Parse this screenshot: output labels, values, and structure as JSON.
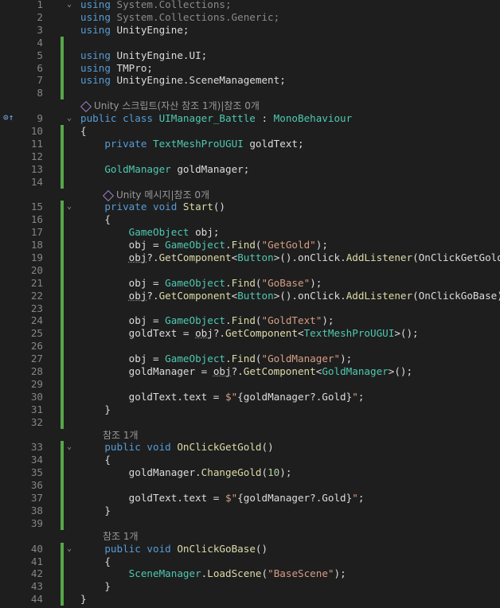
{
  "lenses": {
    "class_refs": "Unity 스크립트(자산 참조 1개)|참조 0개",
    "start_refs": "Unity 메시지|참조 0개",
    "getgold_refs": "참조 1개",
    "gobase_refs": "참조 1개"
  },
  "colors": {
    "added_line_marker": "#57a64a",
    "keyword": "#569cd6",
    "type": "#4ec9b0",
    "string": "#d69d85",
    "method": "#dcdcaa"
  },
  "lines": [
    {
      "n": "1",
      "t": [
        [
          "kw",
          "using "
        ],
        [
          "dim",
          "System.Collections;"
        ]
      ],
      "fold": "⌄",
      "mod": false
    },
    {
      "n": "2",
      "t": [
        [
          "kw",
          "using "
        ],
        [
          "dim",
          "System.Collections.Generic;"
        ]
      ],
      "mod": false
    },
    {
      "n": "3",
      "t": [
        [
          "kw",
          "using "
        ],
        [
          "pl",
          "UnityEngine;"
        ]
      ],
      "mod": false
    },
    {
      "n": "4",
      "t": [],
      "mod": true
    },
    {
      "n": "5",
      "t": [
        [
          "kw",
          "using "
        ],
        [
          "pl",
          "UnityEngine.UI;"
        ]
      ],
      "mod": true
    },
    {
      "n": "6",
      "t": [
        [
          "kw",
          "using "
        ],
        [
          "pl",
          "TMPro;"
        ]
      ],
      "mod": true
    },
    {
      "n": "7",
      "t": [
        [
          "kw",
          "using "
        ],
        [
          "pl",
          "UnityEngine.SceneManagement;"
        ]
      ],
      "mod": true
    },
    {
      "n": "8",
      "t": [],
      "mod": true
    },
    {
      "lens": "class_refs",
      "indent": 0
    },
    {
      "n": "9",
      "t": [
        [
          "kw",
          "public class "
        ],
        [
          "ty",
          "UIManager_Battle"
        ],
        [
          "pl",
          " : "
        ],
        [
          "ty",
          "MonoBehaviour"
        ]
      ],
      "fold": "⌄",
      "bookmark": true
    },
    {
      "n": "10",
      "t": [
        [
          "pl",
          "{"
        ]
      ],
      "mod": true
    },
    {
      "n": "11",
      "t": [
        [
          "pl",
          "    "
        ],
        [
          "kw",
          "private "
        ],
        [
          "ty",
          "TextMeshProUGUI"
        ],
        [
          "pl",
          " goldText;"
        ]
      ],
      "mod": true
    },
    {
      "n": "12",
      "t": [],
      "mod": true
    },
    {
      "n": "13",
      "t": [
        [
          "pl",
          "    "
        ],
        [
          "ty",
          "GoldManager"
        ],
        [
          "pl",
          " goldManager;"
        ]
      ],
      "mod": true
    },
    {
      "n": "14",
      "t": [],
      "mod": true
    },
    {
      "lens": "start_refs",
      "indent": 1
    },
    {
      "n": "15",
      "t": [
        [
          "pl",
          "    "
        ],
        [
          "kw",
          "private void "
        ],
        [
          "mth",
          "Start"
        ],
        [
          "pl",
          "()"
        ]
      ],
      "fold": "⌄",
      "mod": true
    },
    {
      "n": "16",
      "t": [
        [
          "pl",
          "    {"
        ]
      ],
      "mod": true
    },
    {
      "n": "17",
      "t": [
        [
          "pl",
          "        "
        ],
        [
          "ty",
          "GameObject"
        ],
        [
          "pl",
          " obj;"
        ]
      ],
      "mod": true
    },
    {
      "n": "18",
      "t": [
        [
          "pl",
          "        obj = "
        ],
        [
          "ty",
          "GameObject"
        ],
        [
          "pl",
          "."
        ],
        [
          "mth",
          "Find"
        ],
        [
          "pl",
          "("
        ],
        [
          "str",
          "\"GetGold\""
        ],
        [
          "pl",
          ");"
        ]
      ],
      "mod": true
    },
    {
      "n": "19",
      "t": [
        [
          "pl",
          "        "
        ],
        [
          "sq",
          "obj"
        ],
        [
          "pl",
          "?."
        ],
        [
          "mth",
          "GetComponent"
        ],
        [
          "pl",
          "<"
        ],
        [
          "ty",
          "Button"
        ],
        [
          "pl",
          ">().onClick."
        ],
        [
          "mth",
          "AddListener"
        ],
        [
          "pl",
          "(OnClickGetGold);"
        ]
      ],
      "mod": true
    },
    {
      "n": "20",
      "t": [],
      "mod": true
    },
    {
      "n": "21",
      "t": [
        [
          "pl",
          "        obj = "
        ],
        [
          "ty",
          "GameObject"
        ],
        [
          "pl",
          "."
        ],
        [
          "mth",
          "Find"
        ],
        [
          "pl",
          "("
        ],
        [
          "str",
          "\"GoBase\""
        ],
        [
          "pl",
          ");"
        ]
      ],
      "mod": true
    },
    {
      "n": "22",
      "t": [
        [
          "pl",
          "        "
        ],
        [
          "sq",
          "obj"
        ],
        [
          "pl",
          "?."
        ],
        [
          "mth",
          "GetComponent"
        ],
        [
          "pl",
          "<"
        ],
        [
          "ty",
          "Button"
        ],
        [
          "pl",
          ">().onClick."
        ],
        [
          "mth",
          "AddListener"
        ],
        [
          "pl",
          "(OnClickGoBase);"
        ]
      ],
      "mod": true
    },
    {
      "n": "23",
      "t": [],
      "mod": true
    },
    {
      "n": "24",
      "t": [
        [
          "pl",
          "        obj = "
        ],
        [
          "ty",
          "GameObject"
        ],
        [
          "pl",
          "."
        ],
        [
          "mth",
          "Find"
        ],
        [
          "pl",
          "("
        ],
        [
          "str",
          "\"GoldText\""
        ],
        [
          "pl",
          ");"
        ]
      ],
      "mod": true
    },
    {
      "n": "25",
      "t": [
        [
          "pl",
          "        goldText = "
        ],
        [
          "sq",
          "obj"
        ],
        [
          "pl",
          "?."
        ],
        [
          "mth",
          "GetComponent"
        ],
        [
          "pl",
          "<"
        ],
        [
          "ty",
          "TextMeshProUGUI"
        ],
        [
          "pl",
          ">();"
        ]
      ],
      "mod": true
    },
    {
      "n": "26",
      "t": [],
      "mod": true
    },
    {
      "n": "27",
      "t": [
        [
          "pl",
          "        obj = "
        ],
        [
          "ty",
          "GameObject"
        ],
        [
          "pl",
          "."
        ],
        [
          "mth",
          "Find"
        ],
        [
          "pl",
          "("
        ],
        [
          "str",
          "\"GoldManager\""
        ],
        [
          "pl",
          ");"
        ]
      ],
      "mod": true
    },
    {
      "n": "28",
      "t": [
        [
          "pl",
          "        goldManager = "
        ],
        [
          "sq",
          "obj"
        ],
        [
          "pl",
          "?."
        ],
        [
          "mth",
          "GetComponent"
        ],
        [
          "pl",
          "<"
        ],
        [
          "ty",
          "GoldManager"
        ],
        [
          "pl",
          ">();"
        ]
      ],
      "mod": true
    },
    {
      "n": "29",
      "t": [],
      "mod": true
    },
    {
      "n": "30",
      "t": [
        [
          "pl",
          "        goldText.text = "
        ],
        [
          "str",
          "$\""
        ],
        [
          "pl",
          "{goldManager?.Gold}"
        ],
        [
          "str",
          "\""
        ],
        [
          "pl",
          ";"
        ]
      ],
      "mod": true
    },
    {
      "n": "31",
      "t": [
        [
          "pl",
          "    }"
        ]
      ],
      "mod": true
    },
    {
      "n": "32",
      "t": [],
      "mod": true
    },
    {
      "lens": "getgold_refs",
      "indent": 1
    },
    {
      "n": "33",
      "t": [
        [
          "pl",
          "    "
        ],
        [
          "kw",
          "public void "
        ],
        [
          "mth",
          "OnClickGetGold"
        ],
        [
          "pl",
          "()"
        ]
      ],
      "fold": "⌄",
      "mod": true
    },
    {
      "n": "34",
      "t": [
        [
          "pl",
          "    {"
        ]
      ],
      "mod": true
    },
    {
      "n": "35",
      "t": [
        [
          "pl",
          "        goldManager."
        ],
        [
          "mth",
          "ChangeGold"
        ],
        [
          "pl",
          "("
        ],
        [
          "num",
          "10"
        ],
        [
          "pl",
          ");"
        ]
      ],
      "mod": true
    },
    {
      "n": "36",
      "t": [],
      "mod": true
    },
    {
      "n": "37",
      "t": [
        [
          "pl",
          "        goldText.text = "
        ],
        [
          "str",
          "$\""
        ],
        [
          "pl",
          "{goldManager?.Gold}"
        ],
        [
          "str",
          "\""
        ],
        [
          "pl",
          ";"
        ]
      ],
      "mod": true
    },
    {
      "n": "38",
      "t": [
        [
          "pl",
          "    }"
        ]
      ],
      "mod": true
    },
    {
      "n": "39",
      "t": [],
      "mod": true
    },
    {
      "lens": "gobase_refs",
      "indent": 1
    },
    {
      "n": "40",
      "t": [
        [
          "pl",
          "    "
        ],
        [
          "kw",
          "public void "
        ],
        [
          "mth",
          "OnClickGoBase"
        ],
        [
          "pl",
          "()"
        ]
      ],
      "fold": "⌄",
      "mod": true
    },
    {
      "n": "41",
      "t": [
        [
          "pl",
          "    {"
        ]
      ],
      "mod": true
    },
    {
      "n": "42",
      "t": [
        [
          "pl",
          "        "
        ],
        [
          "ty",
          "SceneManager"
        ],
        [
          "pl",
          "."
        ],
        [
          "mth",
          "LoadScene"
        ],
        [
          "pl",
          "("
        ],
        [
          "str",
          "\"BaseScene\""
        ],
        [
          "pl",
          ");"
        ]
      ],
      "mod": true
    },
    {
      "n": "43",
      "t": [
        [
          "pl",
          "    }"
        ]
      ],
      "mod": true
    },
    {
      "n": "44",
      "t": [
        [
          "pl",
          "}"
        ]
      ],
      "mod": true
    }
  ]
}
